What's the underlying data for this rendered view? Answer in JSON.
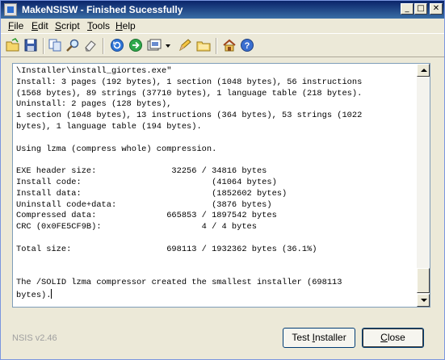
{
  "window": {
    "title": "MakeNSISW - Finished Sucessfully"
  },
  "title_buttons": {
    "minimize": "_",
    "maximize": "□",
    "close": "✕"
  },
  "menu": {
    "items": [
      {
        "label_first": "F",
        "label_rest": "ile"
      },
      {
        "label_first": "E",
        "label_rest": "dit"
      },
      {
        "label_first": "S",
        "label_rest": "cript"
      },
      {
        "label_first": "T",
        "label_rest": "ools"
      },
      {
        "label_first": "H",
        "label_rest": "elp"
      }
    ]
  },
  "toolbar": {
    "icons": [
      "open-folder-icon",
      "save-icon",
      "copy-icon",
      "find-icon",
      "clear-icon",
      "recompile-icon",
      "test-icon",
      "compressor-icon",
      "dropdown-arrow-icon",
      "edit-script-icon",
      "browse-script-icon",
      "nsis-home-icon",
      "help-icon"
    ]
  },
  "log": {
    "lines": [
      "\\Installer\\install_giortes.exe\"",
      "Install: 3 pages (192 bytes), 1 section (1048 bytes), 56 instructions",
      "(1568 bytes), 89 strings (37710 bytes), 1 language table (218 bytes).",
      "Uninstall: 2 pages (128 bytes),",
      "1 section (1048 bytes), 13 instructions (364 bytes), 53 strings (1022",
      "bytes), 1 language table (194 bytes).",
      "",
      "Using lzma (compress whole) compression.",
      "",
      "EXE header size:               32256 / 34816 bytes",
      "Install code:                          (41064 bytes)",
      "Install data:                          (1852602 bytes)",
      "Uninstall code+data:                   (3876 bytes)",
      "Compressed data:              665853 / 1897542 bytes",
      "CRC (0x0FE5CF9B):                    4 / 4 bytes",
      "",
      "Total size:                   698113 / 1932362 bytes (36.1%)",
      "",
      "",
      "The /SOLID lzma compressor created the smallest installer (698113",
      "bytes)."
    ]
  },
  "status": {
    "version": "NSIS v2.46"
  },
  "buttons": {
    "test_pre": "Test ",
    "test_u": "I",
    "test_post": "nstaller",
    "close_u": "C",
    "close_post": "lose"
  }
}
